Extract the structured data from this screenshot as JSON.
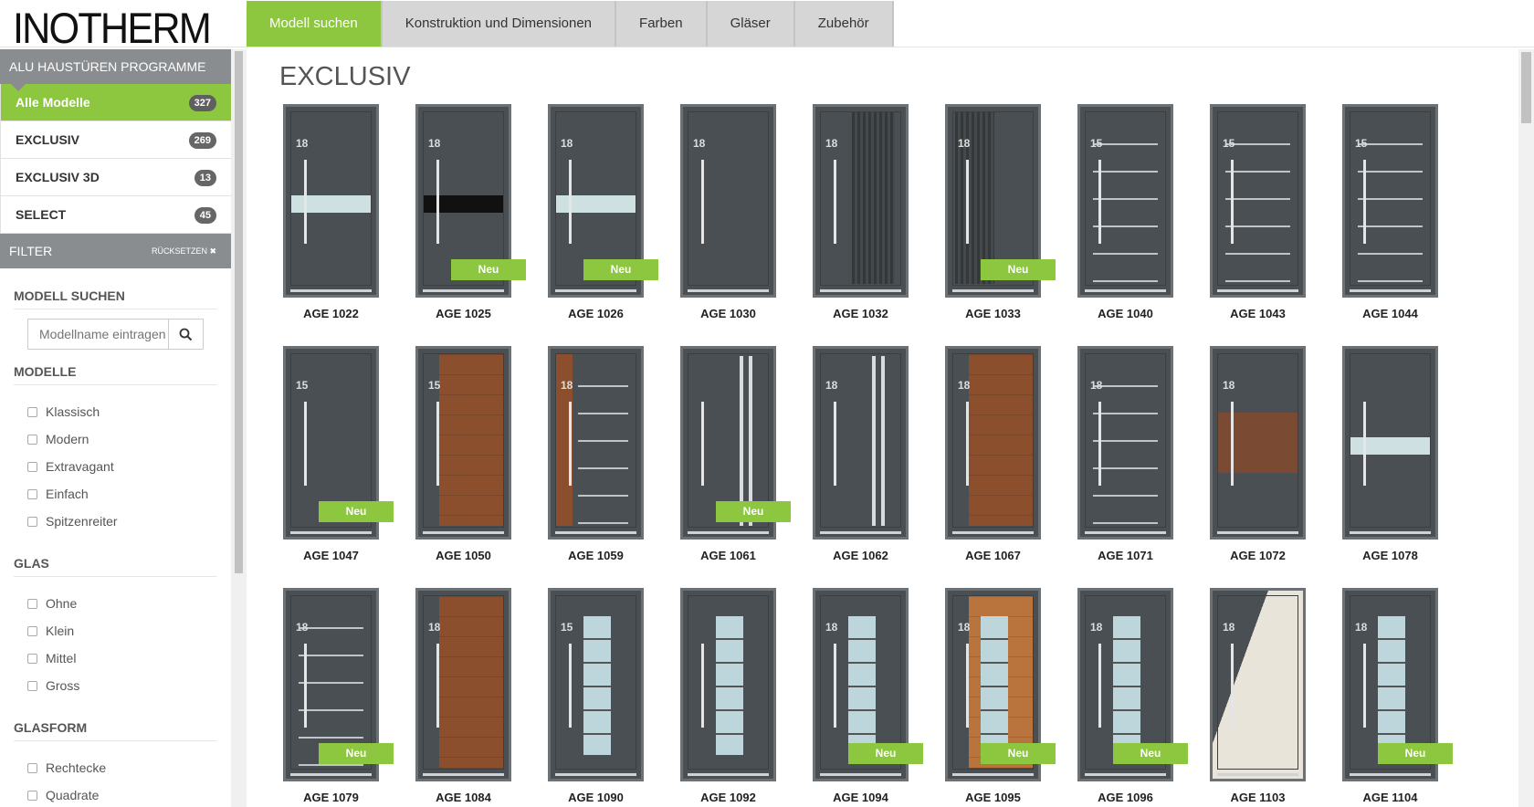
{
  "header": {
    "logo": "INOTHERM",
    "nav": [
      "Modell suchen",
      "Konstruktion und Dimensionen",
      "Farben",
      "Gläser",
      "Zubehör"
    ]
  },
  "sidebar": {
    "programs_title": "ALU HAUSTÜREN PROGRAMME",
    "programs": [
      {
        "label": "Alle Modelle",
        "count": "327"
      },
      {
        "label": "EXCLUSIV",
        "count": "269"
      },
      {
        "label": "EXCLUSIV 3D",
        "count": "13"
      },
      {
        "label": "SELECT",
        "count": "45"
      }
    ],
    "filter_title": "FILTER",
    "reset_label": "RÜCKSETZEN ✖",
    "search_title": "MODELL SUCHEN",
    "search_placeholder": "Modellname eintragen",
    "modelle_title": "MODELLE",
    "modelle": [
      "Klassisch",
      "Modern",
      "Extravagant",
      "Einfach",
      "Spitzenreiter"
    ],
    "glas_title": "GLAS",
    "glas": [
      "Ohne",
      "Klein",
      "Mittel",
      "Gross"
    ],
    "glasform_title": "GLASFORM",
    "glasform": [
      "Rechtecke",
      "Quadrate"
    ]
  },
  "main": {
    "title": "EXCLUSIV",
    "badge_label": "Neu",
    "doors": [
      {
        "name": "AGE 1022",
        "new": false,
        "style": "glass-bar",
        "num": "18"
      },
      {
        "name": "AGE 1025",
        "new": true,
        "style": "dark-bar",
        "num": "18"
      },
      {
        "name": "AGE 1026",
        "new": true,
        "style": "glass-bar",
        "num": "18"
      },
      {
        "name": "AGE 1030",
        "new": false,
        "style": "plain",
        "num": "18"
      },
      {
        "name": "AGE 1032",
        "new": false,
        "style": "wave",
        "num": "18"
      },
      {
        "name": "AGE 1033",
        "new": true,
        "style": "wave",
        "num": "18"
      },
      {
        "name": "AGE 1040",
        "new": false,
        "style": "lines",
        "num": "15"
      },
      {
        "name": "AGE 1043",
        "new": false,
        "style": "lines",
        "num": "15"
      },
      {
        "name": "AGE 1044",
        "new": false,
        "style": "lines",
        "num": "15"
      },
      {
        "name": "AGE 1047",
        "new": true,
        "style": "plain",
        "num": "15"
      },
      {
        "name": "AGE 1050",
        "new": false,
        "style": "wood",
        "num": "15"
      },
      {
        "name": "AGE 1059",
        "new": false,
        "style": "lines-wood",
        "num": "18"
      },
      {
        "name": "AGE 1061",
        "new": true,
        "style": "plain",
        "num": ""
      },
      {
        "name": "AGE 1062",
        "new": false,
        "style": "plain",
        "num": "18"
      },
      {
        "name": "AGE 1067",
        "new": false,
        "style": "wood",
        "num": "18"
      },
      {
        "name": "AGE 1071",
        "new": false,
        "style": "lines",
        "num": "18"
      },
      {
        "name": "AGE 1072",
        "new": false,
        "style": "wood-band",
        "num": "18"
      },
      {
        "name": "AGE 1078",
        "new": false,
        "style": "glass-bar",
        "num": ""
      },
      {
        "name": "AGE 1079",
        "new": true,
        "style": "lines",
        "num": "18"
      },
      {
        "name": "AGE 1084",
        "new": false,
        "style": "wood",
        "num": "18"
      },
      {
        "name": "AGE 1090",
        "new": false,
        "style": "glass-col",
        "num": "15"
      },
      {
        "name": "AGE 1092",
        "new": false,
        "style": "glass-col",
        "num": ""
      },
      {
        "name": "AGE 1094",
        "new": true,
        "style": "glass-col",
        "num": "18"
      },
      {
        "name": "AGE 1095",
        "new": true,
        "style": "wood-glass",
        "num": "18"
      },
      {
        "name": "AGE 1096",
        "new": true,
        "style": "glass-col",
        "num": "18"
      },
      {
        "name": "AGE 1103",
        "new": false,
        "style": "light",
        "num": "18"
      },
      {
        "name": "AGE 1104",
        "new": true,
        "style": "glass-col",
        "num": "18"
      }
    ]
  }
}
